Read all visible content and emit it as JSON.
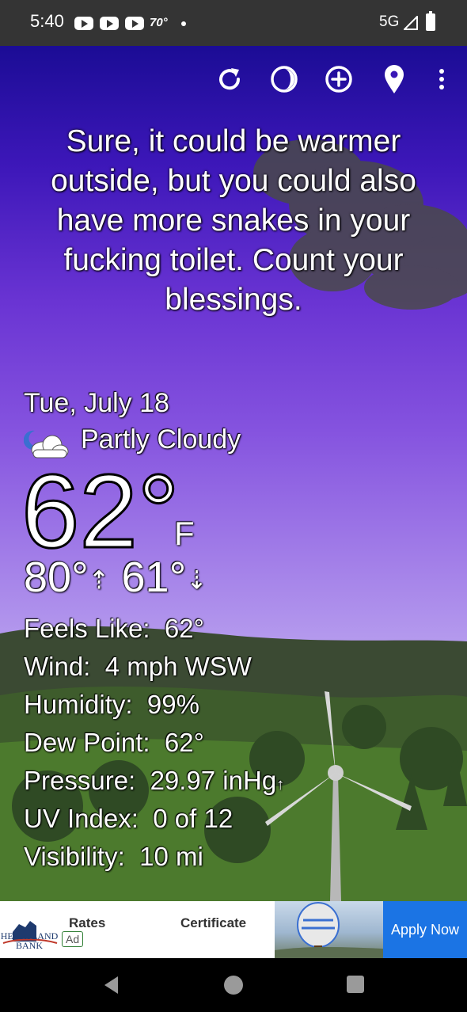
{
  "status_bar": {
    "time": "5:40",
    "temp": "70°",
    "network": "5G"
  },
  "toolbar": {
    "refresh_icon": "refresh-icon",
    "moon_icon": "moon-phase-icon",
    "add_icon": "add-location-icon",
    "location_icon": "location-pin-icon",
    "menu_icon": "more-vert-icon"
  },
  "message": "Sure, it could be warmer outside, but you could also have more snakes in your fucking toilet. Count your blessings.",
  "weather": {
    "date": "Tue, July 18",
    "condition": "Partly Cloudy",
    "condition_icon": "partly-cloudy-night-icon",
    "temperature": "62°",
    "unit": "F",
    "high": "80°",
    "low": "61°",
    "details": [
      {
        "label": "Feels Like:",
        "value": "62°",
        "suffix": ""
      },
      {
        "label": "Wind:",
        "value": "4 mph WSW",
        "suffix": ""
      },
      {
        "label": "Humidity:",
        "value": "99%",
        "suffix": ""
      },
      {
        "label": "Dew Point:",
        "value": "62°",
        "suffix": ""
      },
      {
        "label": "Pressure:",
        "value": "29.97 inHg",
        "suffix": "↑"
      },
      {
        "label": "UV Index:",
        "value": "0 of 12",
        "suffix": ""
      },
      {
        "label": "Visibility:",
        "value": "10 mi",
        "suffix": ""
      }
    ]
  },
  "ad": {
    "logo_line1": "HEARTLAND",
    "logo_line2": "BANK",
    "badge": "Ad",
    "text1": "Rates",
    "text2": "Certificate",
    "cta": "Apply Now"
  },
  "navbar": {
    "back": "back-icon",
    "home": "home-icon",
    "recents": "recents-icon"
  }
}
